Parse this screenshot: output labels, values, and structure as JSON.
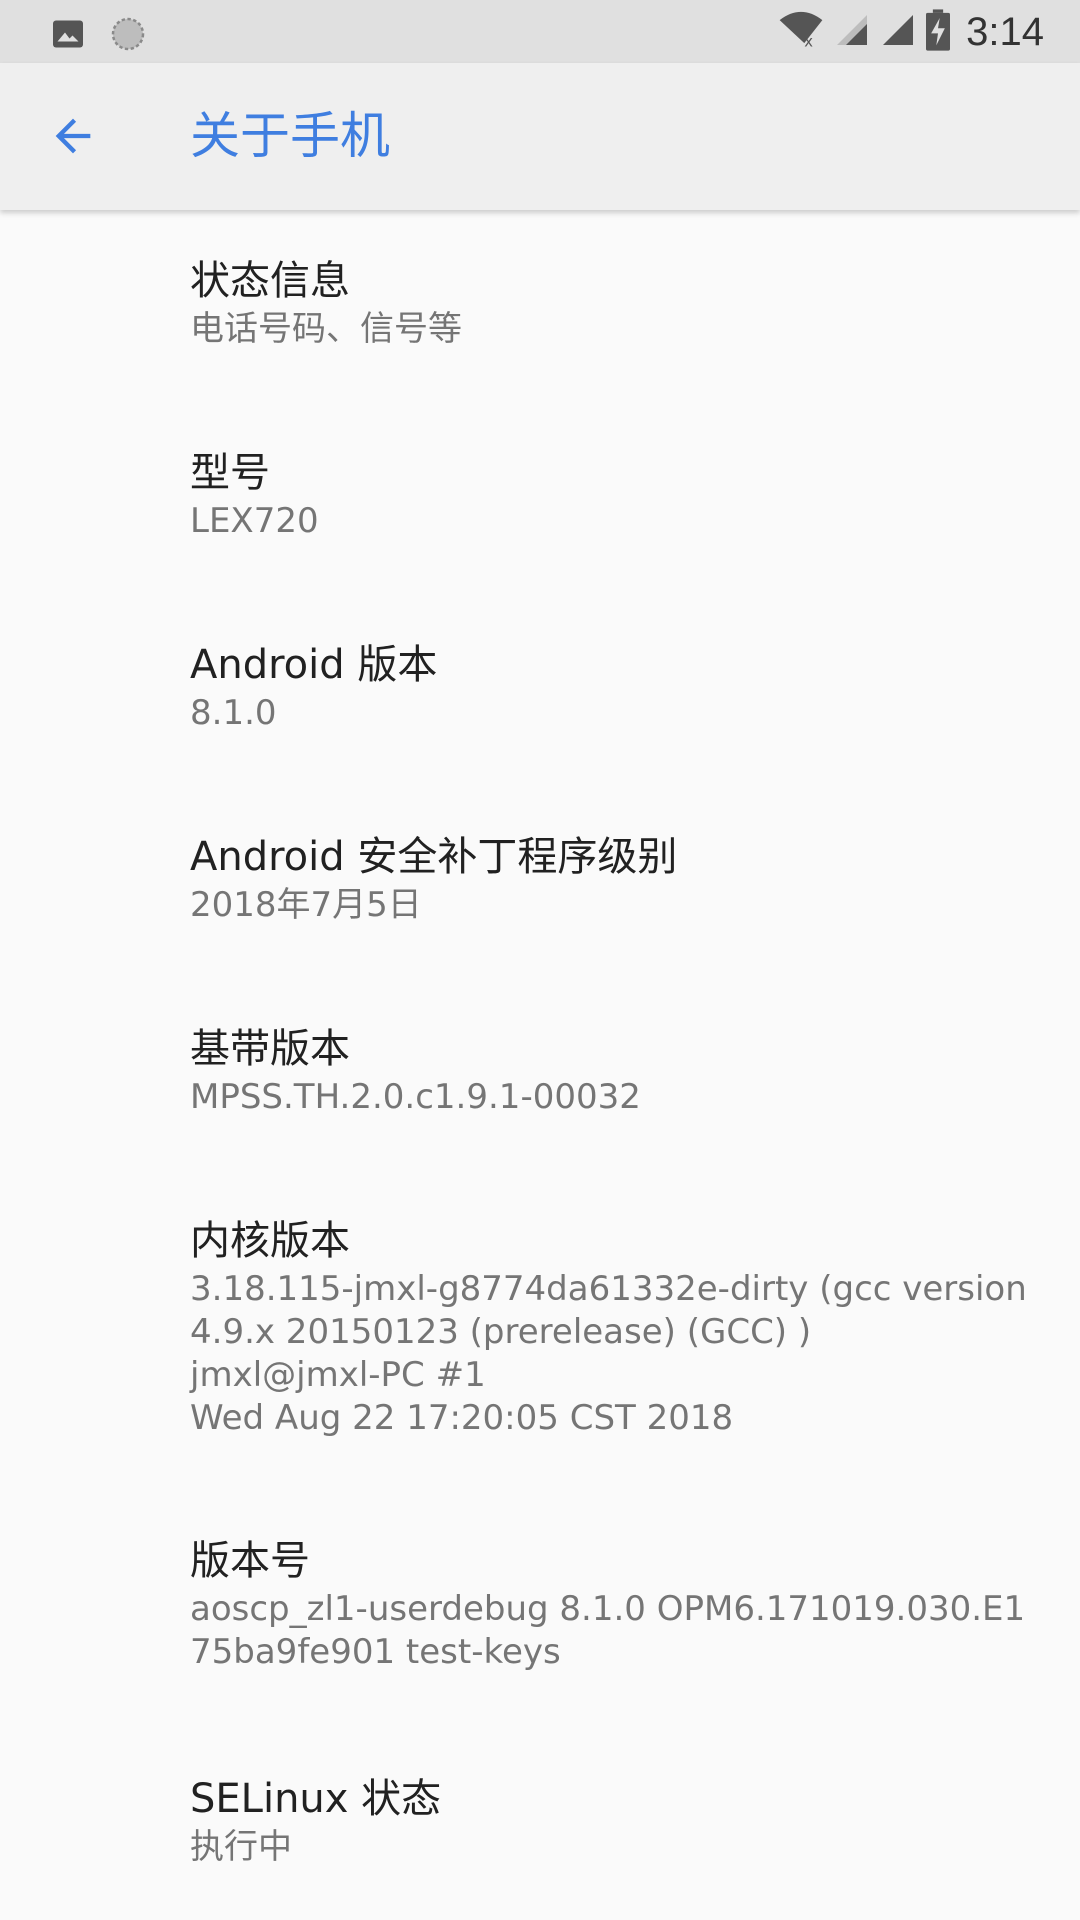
{
  "status_bar": {
    "time": "3:14",
    "left_icons": [
      "image-notification-icon",
      "sync-notification-icon"
    ],
    "right_icons": [
      "wifi-no-internet-icon",
      "signal-icon",
      "signal-icon",
      "battery-charging-icon"
    ]
  },
  "app_bar": {
    "back_icon": "arrow-back-icon",
    "title": "关于手机",
    "accent_color": "#3f7ee0"
  },
  "items": [
    {
      "key": "status",
      "title": "状态信息",
      "summary_lines": [
        "电话号码、信号等"
      ]
    },
    {
      "key": "model",
      "title": "型号",
      "summary_lines": [
        "LEX720"
      ]
    },
    {
      "key": "android",
      "title": "Android 版本",
      "summary_lines": [
        "8.1.0"
      ]
    },
    {
      "key": "patch",
      "title": "Android 安全补丁程序级别",
      "summary_lines": [
        "2018年7月5日"
      ]
    },
    {
      "key": "baseband",
      "title": "基带版本",
      "summary_lines": [
        "MPSS.TH.2.0.c1.9.1-00032"
      ]
    },
    {
      "key": "kernel",
      "title": "内核版本",
      "summary_lines": [
        "3.18.115-jmxl-g8774da61332e-dirty (gcc version",
        "4.9.x 20150123 (prerelease) (GCC) )",
        "jmxl@jmxl-PC #1",
        "Wed Aug 22 17:20:05 CST 2018"
      ]
    },
    {
      "key": "build",
      "title": "版本号",
      "summary_lines": [
        "aoscp_zl1-userdebug 8.1.0 OPM6.171019.030.E1",
        "75ba9fe901 test-keys"
      ]
    },
    {
      "key": "selinux",
      "title": "SELinux 状态",
      "summary_lines": [
        "执行中"
      ]
    }
  ]
}
